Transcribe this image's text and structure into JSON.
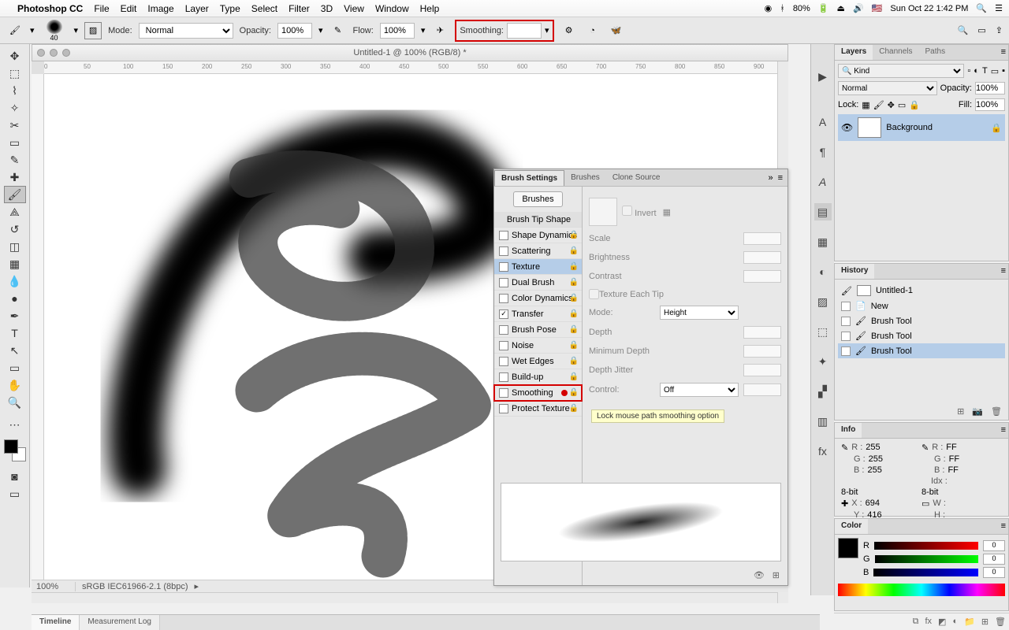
{
  "menubar": {
    "app": "Photoshop CC",
    "items": [
      "File",
      "Edit",
      "Image",
      "Layer",
      "Type",
      "Select",
      "Filter",
      "3D",
      "View",
      "Window",
      "Help"
    ],
    "battery": "80%",
    "datetime": "Sun Oct 22  1:42 PM"
  },
  "optbar": {
    "brush_size": "40",
    "mode_label": "Mode:",
    "mode_value": "Normal",
    "opacity_label": "Opacity:",
    "opacity_value": "100%",
    "flow_label": "Flow:",
    "flow_value": "100%",
    "smoothing_label": "Smoothing:",
    "smoothing_value": ""
  },
  "document": {
    "title": "Untitled-1 @ 100% (RGB/8) *",
    "zoom": "100%",
    "profile": "sRGB IEC61966-2.1 (8bpc)",
    "ruler_ticks": [
      "0",
      "50",
      "100",
      "150",
      "200",
      "250",
      "300",
      "350",
      "400",
      "450",
      "500",
      "550",
      "600",
      "650",
      "700",
      "750",
      "800",
      "850",
      "900"
    ]
  },
  "brush_settings": {
    "tabs": [
      "Brush Settings",
      "Brushes",
      "Clone Source"
    ],
    "brushes_btn": "Brushes",
    "tip_header": "Brush Tip Shape",
    "options": [
      {
        "label": "Shape Dynamics",
        "checked": false
      },
      {
        "label": "Scattering",
        "checked": false
      },
      {
        "label": "Texture",
        "checked": false,
        "selected": true
      },
      {
        "label": "Dual Brush",
        "checked": false
      },
      {
        "label": "Color Dynamics",
        "checked": false
      },
      {
        "label": "Transfer",
        "checked": true
      },
      {
        "label": "Brush Pose",
        "checked": false
      },
      {
        "label": "Noise",
        "checked": false
      },
      {
        "label": "Wet Edges",
        "checked": false
      },
      {
        "label": "Build-up",
        "checked": false
      },
      {
        "label": "Smoothing",
        "checked": false,
        "highlight": true
      },
      {
        "label": "Protect Texture",
        "checked": false
      }
    ],
    "right_fields": {
      "invert": "Invert",
      "scale": "Scale",
      "brightness": "Brightness",
      "contrast": "Contrast",
      "texture_each": "Texture Each Tip",
      "mode_label": "Mode:",
      "mode_value": "Height",
      "depth": "Depth",
      "min_depth": "Minimum Depth",
      "depth_jitter": "Depth Jitter",
      "control_label": "Control:",
      "control_value": "Off"
    },
    "tooltip": "Lock mouse path smoothing option"
  },
  "layers": {
    "tabs": [
      "Layers",
      "Channels",
      "Paths"
    ],
    "kind_placeholder": "Kind",
    "blend_mode": "Normal",
    "opacity_label": "Opacity:",
    "opacity_value": "100%",
    "lock_label": "Lock:",
    "fill_label": "Fill:",
    "fill_value": "100%",
    "layer_name": "Background"
  },
  "history": {
    "tab": "History",
    "doc": "Untitled-1",
    "items": [
      "New",
      "Brush Tool",
      "Brush Tool",
      "Brush Tool"
    ]
  },
  "info": {
    "tab": "Info",
    "R": "255",
    "G": "255",
    "B": "255",
    "R2": "FF",
    "G2": "FF",
    "B2": "FF",
    "idx": "Idx :",
    "bit": "8-bit",
    "bit2": "8-bit",
    "X": "694",
    "Y": "416",
    "W": "",
    "H": ""
  },
  "color": {
    "tab": "Color",
    "R": "0",
    "G": "0",
    "B": "0"
  },
  "bottom_tabs": [
    "Timeline",
    "Measurement Log"
  ]
}
